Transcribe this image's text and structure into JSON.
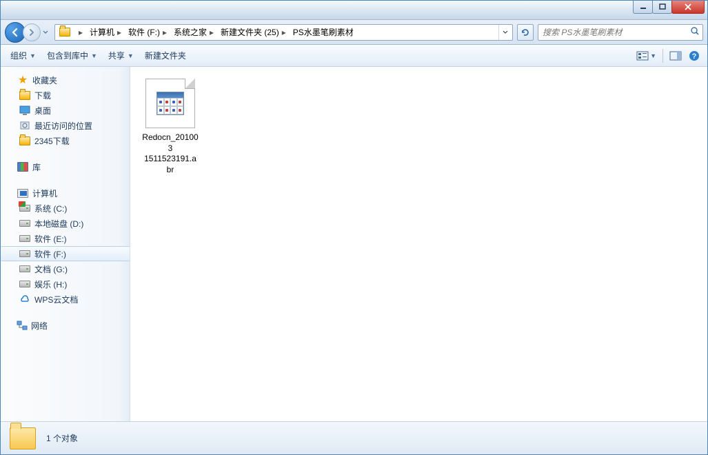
{
  "breadcrumb": {
    "parts": [
      "计算机",
      "软件 (F:)",
      "系统之家",
      "新建文件夹 (25)",
      "PS水墨笔刷素材"
    ]
  },
  "search": {
    "placeholder": "搜索 PS水墨笔刷素材"
  },
  "toolbar": {
    "organize": "组织",
    "include": "包含到库中",
    "share": "共享",
    "newfolder": "新建文件夹"
  },
  "sidebar": {
    "favorites": {
      "label": "收藏夹"
    },
    "fav_items": {
      "downloads": "下载",
      "desktop": "桌面",
      "recent": "最近访问的位置",
      "dl2345": "2345下载"
    },
    "libraries": {
      "label": "库"
    },
    "computer": {
      "label": "计算机"
    },
    "drives": {
      "c": "系统 (C:)",
      "d": "本地磁盘 (D:)",
      "e": "软件 (E:)",
      "f": "软件 (F:)",
      "g": "文档 (G:)",
      "h": "娱乐 (H:)",
      "wps": "WPS云文档"
    },
    "network": {
      "label": "网络"
    }
  },
  "files": {
    "item0": {
      "line1": "Redocn_201003",
      "line2": "1511523191.abr"
    }
  },
  "status": {
    "text": "1 个对象"
  }
}
